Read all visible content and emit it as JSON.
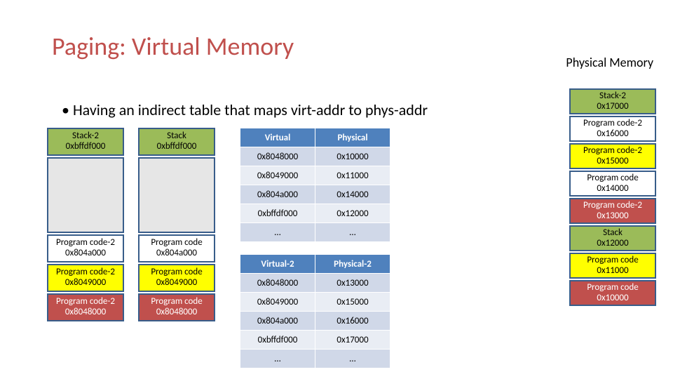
{
  "title": "Paging: Virtual Memory",
  "pm_heading": "Physical Memory",
  "bullet": "Having an indirect table that maps virt-addr to phys-addr",
  "proc2": {
    "stack": {
      "label": "Stack-2",
      "addr": "0xbffdf000"
    },
    "code_a": {
      "label": "Program code-2",
      "addr": "0x804a000"
    },
    "code_9": {
      "label": "Program code-2",
      "addr": "0x8049000"
    },
    "code_8": {
      "label": "Program code-2",
      "addr": "0x8048000"
    }
  },
  "proc1": {
    "stack": {
      "label": "Stack",
      "addr": "0xbffdf000"
    },
    "code_a": {
      "label": "Program code",
      "addr": "0x804a000"
    },
    "code_9": {
      "label": "Program code",
      "addr": "0x8049000"
    },
    "code_8": {
      "label": "Program code",
      "addr": "0x8048000"
    }
  },
  "pt1": {
    "head_v": "Virtual",
    "head_p": "Physical",
    "r0v": "0x8048000",
    "r0p": "0x10000",
    "r1v": "0x8049000",
    "r1p": "0x11000",
    "r2v": "0x804a000",
    "r2p": "0x14000",
    "r3v": "0xbffdf000",
    "r3p": "0x12000",
    "r4v": "…",
    "r4p": "…"
  },
  "pt2": {
    "head_v": "Virtual-2",
    "head_p": "Physical-2",
    "r0v": "0x8048000",
    "r0p": "0x13000",
    "r1v": "0x8049000",
    "r1p": "0x15000",
    "r2v": "0x804a000",
    "r2p": "0x16000",
    "r3v": "0xbffdf000",
    "r3p": "0x17000",
    "r4v": "…",
    "r4p": "…"
  },
  "phys": {
    "p17": {
      "label": "Stack-2",
      "addr": "0x17000"
    },
    "p16": {
      "label": "Program code-2",
      "addr": "0x16000"
    },
    "p15": {
      "label": "Program code-2",
      "addr": "0x15000"
    },
    "p14": {
      "label": "Program code",
      "addr": "0x14000"
    },
    "p13": {
      "label": "Program code-2",
      "addr": "0x13000"
    },
    "p12": {
      "label": "Stack",
      "addr": "0x12000"
    },
    "p11": {
      "label": "Program code",
      "addr": "0x11000"
    },
    "p10": {
      "label": "Program code",
      "addr": "0x10000"
    }
  }
}
